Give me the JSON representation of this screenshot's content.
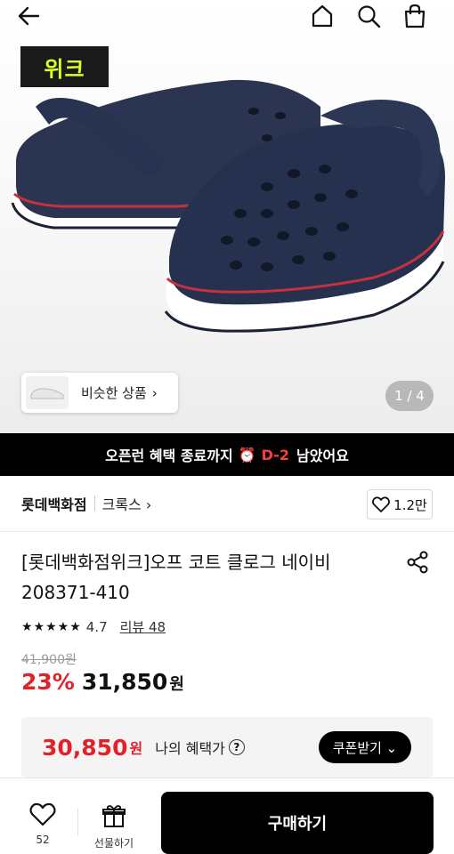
{
  "header": {
    "back_icon": "arrow-left-icon",
    "home_icon": "home-icon",
    "search_icon": "search-icon",
    "bag_icon": "shopping-bag-icon"
  },
  "hero": {
    "badge_text": "위크",
    "similar_label": "비슷한 상품",
    "similar_chevron": "›",
    "page_indicator": "1 / 4",
    "badge_color": "#d8ff2e"
  },
  "banner": {
    "text_before": "오픈런 혜택 종료까지",
    "alarm_icon": "⏰",
    "dday": "D-2",
    "text_after": "남았어요",
    "dday_color": "#ff3b3b"
  },
  "store": {
    "store_name": "롯데백화점",
    "brand": "크록스 ›",
    "like_count": "1.2만"
  },
  "product": {
    "title": "[롯데백화점위크]오프 코트 클로그 네이비 208371-410",
    "stars": "★★★★★",
    "rating": "4.7",
    "review": "리뷰 48",
    "original_price": "41,900원",
    "discount": "23%",
    "sale_price": "31,850",
    "currency": "원"
  },
  "benefit": {
    "price": "30,850",
    "currency": "원",
    "label": "나의 혜택가",
    "info": "?",
    "coupon_button": "쿠폰받기 ⌄",
    "accent_color": "#e0232b"
  },
  "bottom": {
    "wish_count": "52",
    "gift_label": "선물하기",
    "buy_button": "구매하기"
  }
}
